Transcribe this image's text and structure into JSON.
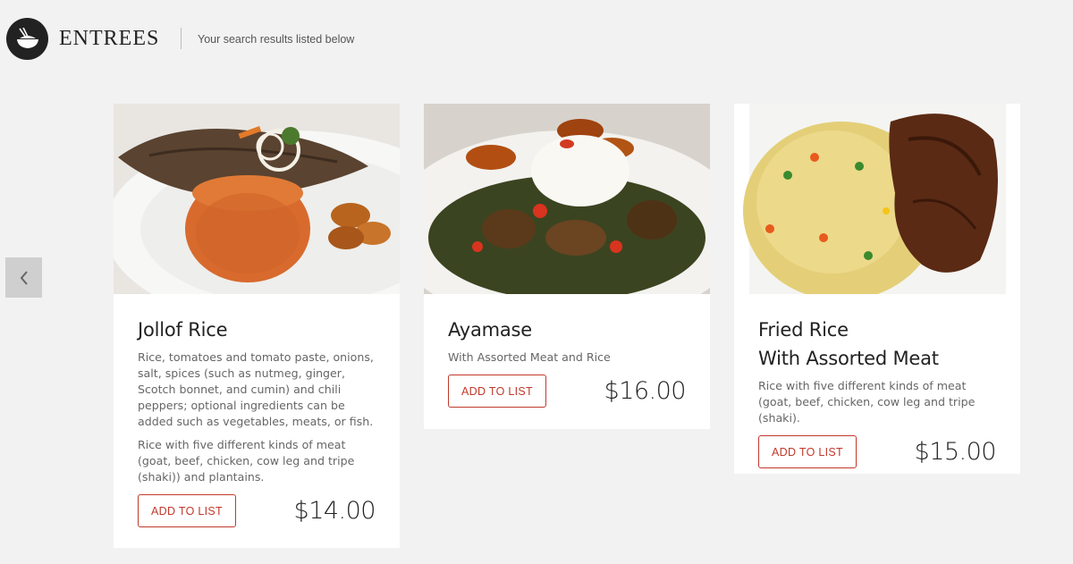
{
  "header": {
    "brand": "ENTREES",
    "tagline": "Your search results listed below",
    "logo_icon": "rice-bowl-icon"
  },
  "carousel": {
    "prev_icon": "chevron-left-icon"
  },
  "items": [
    {
      "name": "Jollof Rice",
      "description": "Rice, tomatoes and tomato paste, onions, salt, spices (such as nutmeg, ginger, Scotch bonnet, and cumin) and chili peppers; optional ingredients can be added such as vegetables, meats, or fish.",
      "extra": "Rice with five different kinds of meat (goat, beef, chicken, cow leg and tripe (shaki)) and plantains.",
      "button": "ADD TO LIST",
      "price": "$14.00"
    },
    {
      "name": "Ayamase",
      "description": "With Assorted Meat and Rice",
      "button": "ADD TO LIST",
      "price": "$16.00"
    },
    {
      "name": "Fried Rice",
      "name_line2": "With Assorted Meat",
      "description": "Rice with five different kinds of meat (goat, beef, chicken, cow leg and tripe (shaki).",
      "button": "ADD TO LIST",
      "price": "$15.00"
    }
  ],
  "colors": {
    "accent": "#c0392b",
    "background": "#f2f2f2",
    "card": "#ffffff"
  }
}
